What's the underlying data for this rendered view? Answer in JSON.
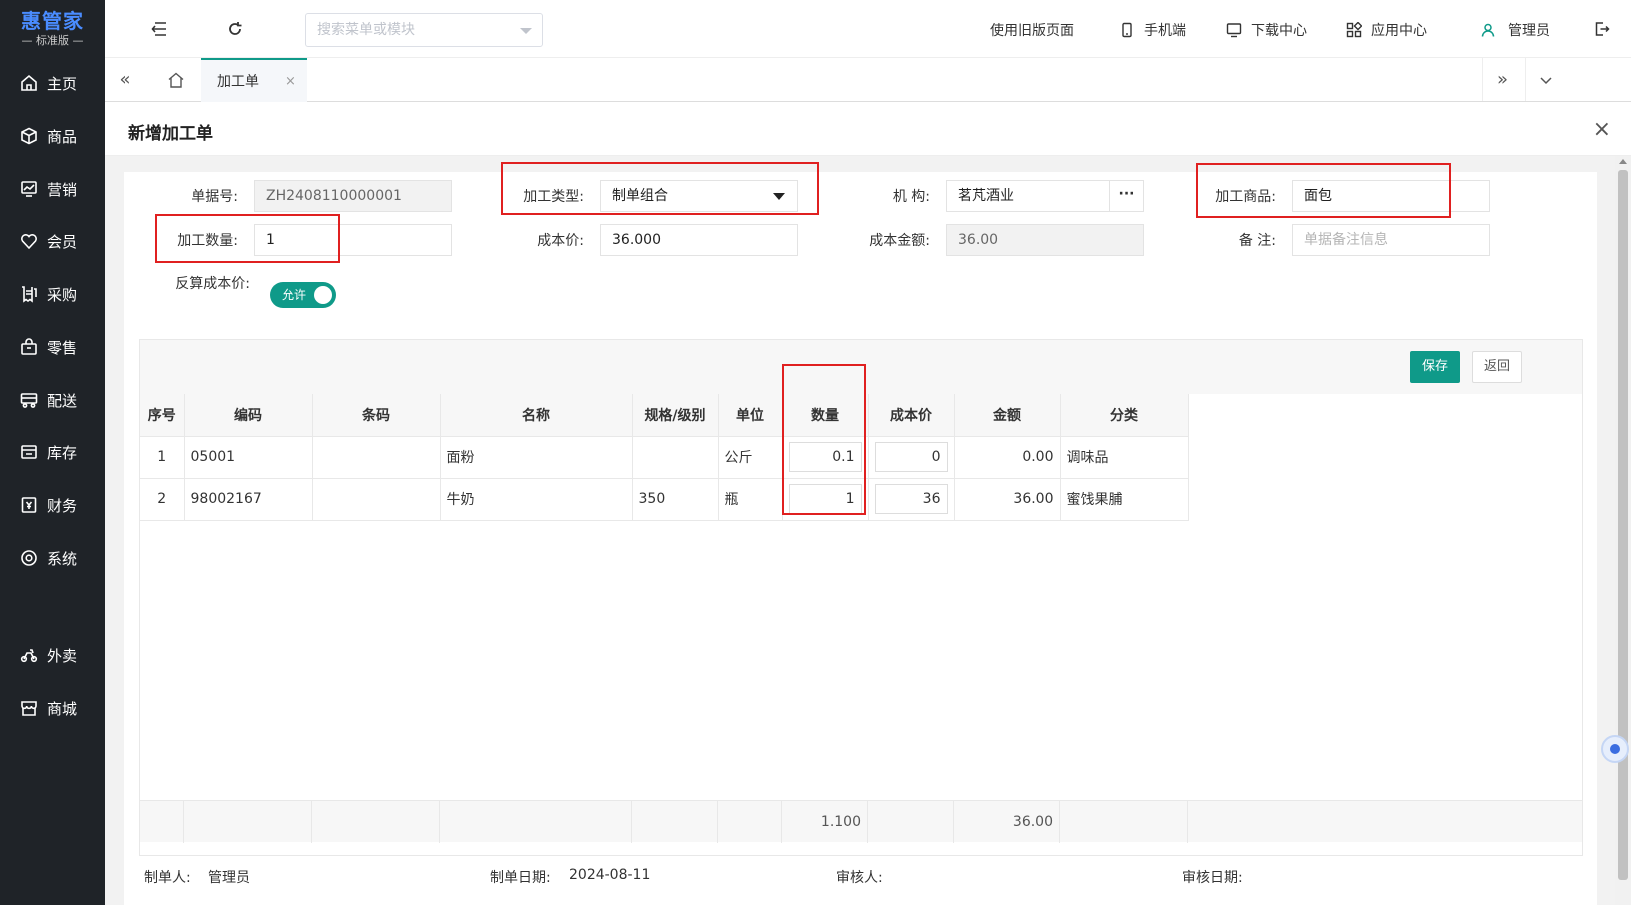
{
  "brand": {
    "name": "惠管家",
    "edition": "标准版"
  },
  "sidebar": {
    "items": [
      {
        "label": "主页",
        "icon": "home-icon"
      },
      {
        "label": "商品",
        "icon": "box-icon"
      },
      {
        "label": "营销",
        "icon": "chart-icon"
      },
      {
        "label": "会员",
        "icon": "heart-icon"
      },
      {
        "label": "采购",
        "icon": "receipt-icon"
      },
      {
        "label": "零售",
        "icon": "bag-icon"
      },
      {
        "label": "配送",
        "icon": "truck-icon"
      },
      {
        "label": "库存",
        "icon": "inventory-icon"
      },
      {
        "label": "财务",
        "icon": "finance-icon"
      },
      {
        "label": "系统",
        "icon": "settings-icon"
      },
      {
        "label": "外卖",
        "icon": "scooter-icon"
      },
      {
        "label": "商城",
        "icon": "store-icon"
      }
    ]
  },
  "topbar": {
    "search_placeholder": "搜索菜单或模块",
    "links": {
      "old_version": "使用旧版页面",
      "mobile": "手机端",
      "download": "下载中心",
      "apps": "应用中心",
      "user": "管理员"
    }
  },
  "tabs": {
    "active": "加工单",
    "close": "×"
  },
  "page": {
    "title": "新增加工单",
    "close": "×"
  },
  "form": {
    "doc_no": {
      "label": "单据号:",
      "value": "ZH2408110000001"
    },
    "proc_type": {
      "label": "加工类型:",
      "value": "制单组合"
    },
    "org": {
      "label": "机 构:",
      "value": "茗芃酒业",
      "more": "···"
    },
    "product": {
      "label": "加工商品:",
      "value": "面包"
    },
    "quantity": {
      "label": "加工数量:",
      "value": "1"
    },
    "cost_price": {
      "label": "成本价:",
      "value": "36.000"
    },
    "cost_amount": {
      "label": "成本金额:",
      "value": "36.00"
    },
    "remark": {
      "label": "备 注:",
      "placeholder": "单据备注信息"
    },
    "reverse": {
      "label": "反算成本价:",
      "toggle_text": "允许"
    }
  },
  "actions": {
    "save": "保存",
    "back": "返回"
  },
  "grid": {
    "headers": [
      "序号",
      "编码",
      "条码",
      "名称",
      "规格/级别",
      "单位",
      "数量",
      "成本价",
      "金额",
      "分类"
    ],
    "rows": [
      {
        "seq": "1",
        "code": "05001",
        "barcode": "",
        "name": "面粉",
        "spec": "",
        "unit": "公斤",
        "qty": "0.1",
        "cost": "0",
        "amount": "0.00",
        "category": "调味品"
      },
      {
        "seq": "2",
        "code": "98002167",
        "barcode": "",
        "name": "牛奶",
        "spec": "350",
        "unit": "瓶",
        "qty": "1",
        "cost": "36",
        "amount": "36.00",
        "category": "蜜饯果脯"
      }
    ],
    "totals": {
      "qty": "1.100",
      "amount": "36.00"
    }
  },
  "footer": {
    "creator_label": "制单人:",
    "creator": "管理员",
    "date_label": "制单日期:",
    "date": "2024-08-11",
    "auditor_label": "审核人:",
    "audit_date_label": "审核日期:"
  },
  "colors": {
    "accent": "#0f9a89",
    "sidebar": "#1f2328",
    "highlight": "#e02020",
    "brand": "#4a8cff"
  }
}
